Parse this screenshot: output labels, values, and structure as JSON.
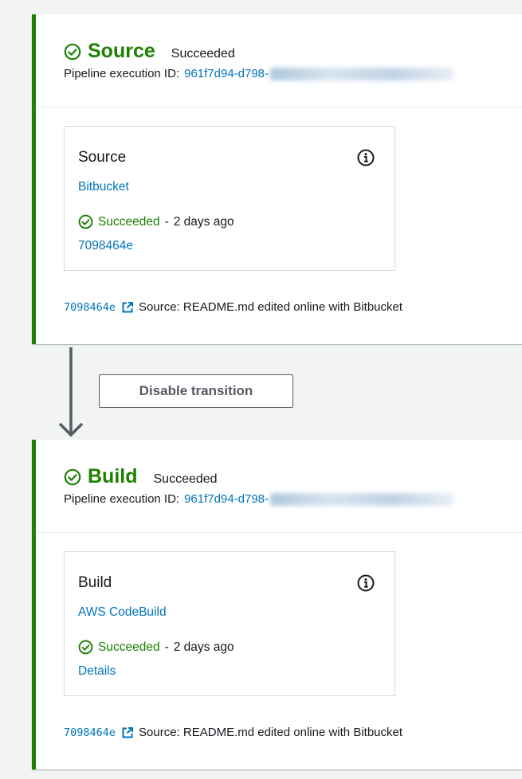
{
  "stages": [
    {
      "name": "Source",
      "status": "Succeeded",
      "execution_label": "Pipeline execution ID:",
      "execution_id": "961f7d94-d798-",
      "action": {
        "name": "Source",
        "provider": "Bitbucket",
        "status": "Succeeded",
        "separator": "-",
        "time": "2 days ago",
        "link": "7098464e"
      },
      "commit": {
        "id": "7098464e",
        "message": "Source: README.md edited online with Bitbucket"
      }
    },
    {
      "name": "Build",
      "status": "Succeeded",
      "execution_label": "Pipeline execution ID:",
      "execution_id": "961f7d94-d798-",
      "action": {
        "name": "Build",
        "provider": "AWS CodeBuild",
        "status": "Succeeded",
        "separator": "-",
        "time": "2 days ago",
        "link": "Details"
      },
      "commit": {
        "id": "7098464e",
        "message": "Source: README.md edited online with Bitbucket"
      }
    }
  ],
  "transition": {
    "button_label": "Disable transition"
  },
  "colors": {
    "success": "#1d8102",
    "link": "#0073bb",
    "text": "#16191f",
    "border": "#d5dbdb"
  }
}
